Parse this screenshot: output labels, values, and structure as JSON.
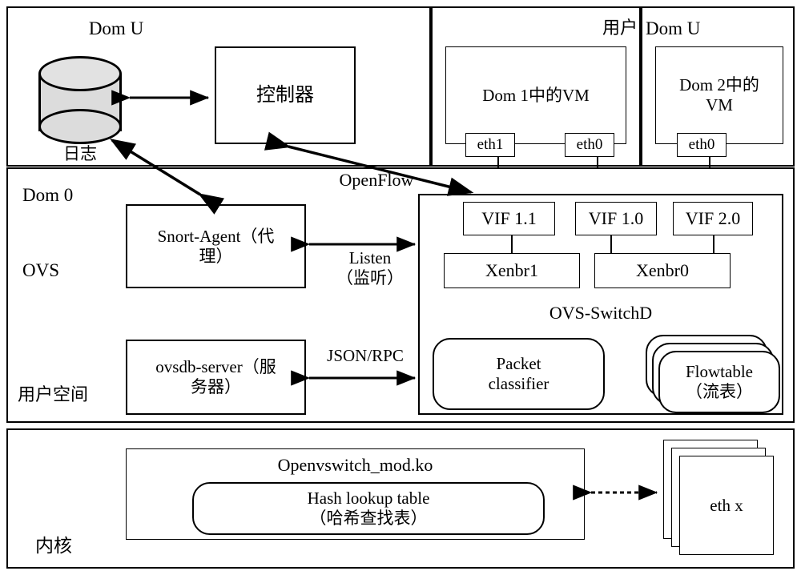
{
  "diagram": {
    "title": "OVS / Xen virtualization architecture diagram",
    "colors": {
      "stroke": "#000000",
      "background": "#ffffff",
      "cylinder_fill": "#dcdcdc"
    }
  },
  "panels": {
    "dom_u_left": {
      "label": "Dom U"
    },
    "user_middle": {
      "label": "用户"
    },
    "dom_u_right": {
      "label": "Dom U"
    },
    "dom0": {
      "label": "Dom 0",
      "ovs_label": "OVS",
      "userspace_label": "用户空间"
    },
    "kernel": {
      "label": "内核"
    }
  },
  "nodes": {
    "log_cylinder": {
      "label": "日志"
    },
    "controller": {
      "label": "控制器"
    },
    "vm1": {
      "label": "Dom 1中的VM"
    },
    "vm2": {
      "label": "Dom 2中的\nVM"
    },
    "eth1_vm1": {
      "label": "eth1"
    },
    "eth0_vm1": {
      "label": "eth0"
    },
    "eth0_vm2": {
      "label": "eth0"
    },
    "snort_agent": {
      "label": "Snort-Agent（代\n理）"
    },
    "ovsdb_server": {
      "label": "ovsdb-server（服\n务器）"
    },
    "vif_1_1": {
      "label": "VIF 1.1"
    },
    "vif_1_0": {
      "label": "VIF 1.0"
    },
    "vif_2_0": {
      "label": "VIF 2.0"
    },
    "xenbr1": {
      "label": "Xenbr1"
    },
    "xenbr0": {
      "label": "Xenbr0"
    },
    "ovs_switchd": {
      "label": "OVS-SwitchD"
    },
    "packet_classifier": {
      "label": "Packet\nclassifier"
    },
    "flowtable": {
      "label": "Flowtable\n（流表）"
    },
    "openvswitch_mod": {
      "label": "Openvswitch_mod.ko"
    },
    "hash_lookup_table": {
      "label": "Hash lookup table\n（哈希查找表）"
    },
    "eth_x": {
      "label": "eth x"
    }
  },
  "edges": {
    "openflow": {
      "label": "OpenFlow"
    },
    "listen": {
      "label": "Listen\n（监听）"
    },
    "jsonrpc": {
      "label": "JSON/RPC"
    }
  }
}
